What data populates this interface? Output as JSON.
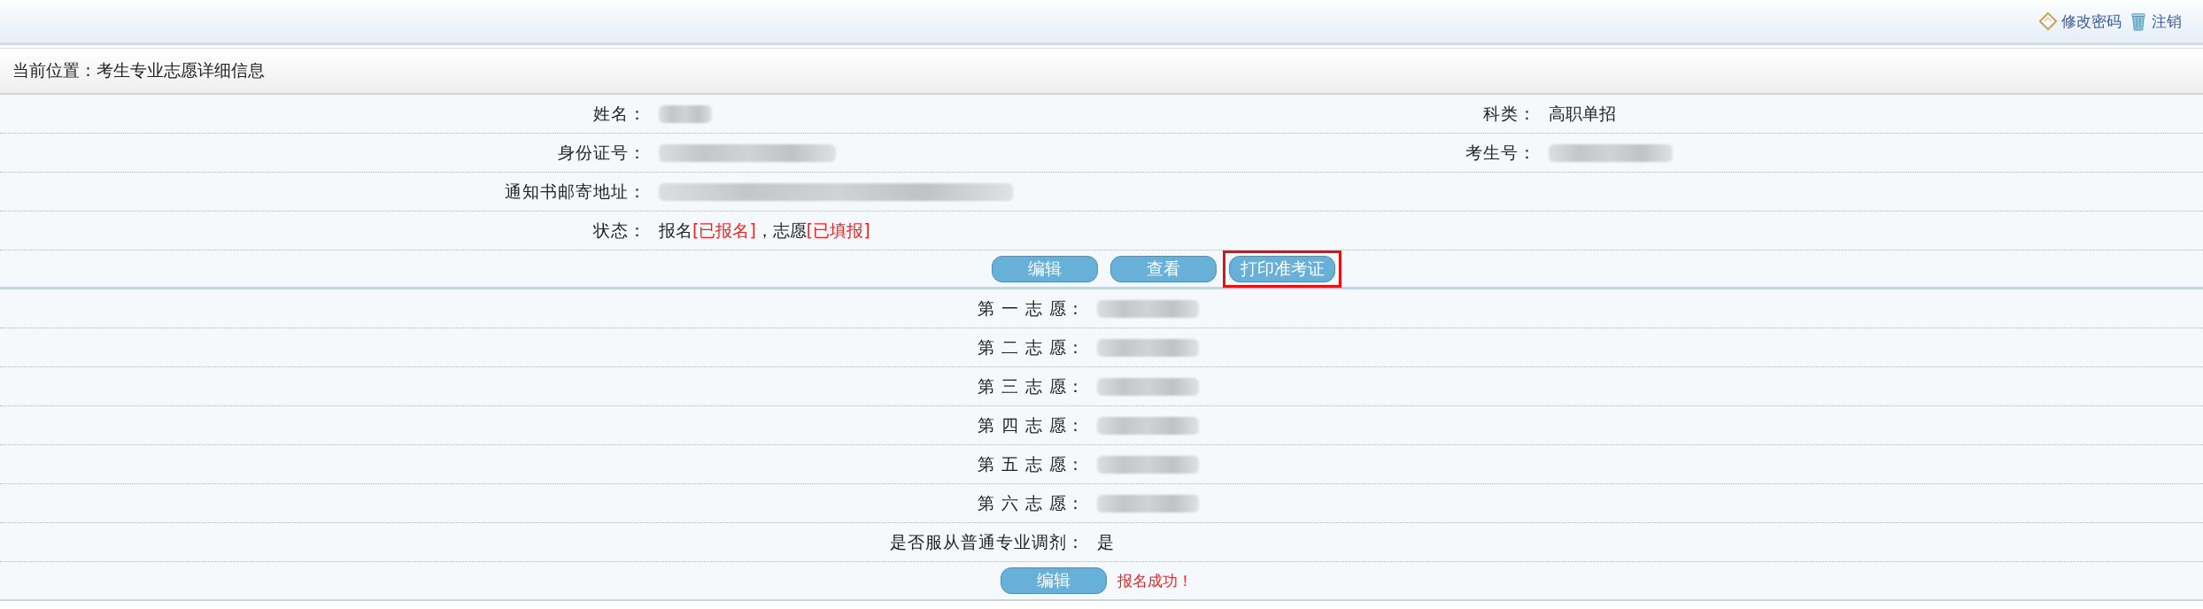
{
  "header": {
    "links": [
      {
        "kind": "password",
        "label": "修改密码"
      },
      {
        "kind": "logout",
        "label": "注销"
      }
    ]
  },
  "breadcrumb": "当前位置：考生专业志愿详细信息",
  "info": {
    "name_label": "姓名：",
    "category_label": "科类：",
    "category_value": "高职单招",
    "id_label": "身份证号：",
    "exam_no_label": "考生号：",
    "address_label": "通知书邮寄地址：",
    "status_label": "状态：",
    "status": [
      {
        "text": "报名",
        "highlight": false
      },
      {
        "text": "[已报名]",
        "highlight": true
      },
      {
        "text": "，志愿",
        "highlight": false
      },
      {
        "text": "[已填报]",
        "highlight": true
      }
    ]
  },
  "actions": [
    {
      "label": "编辑",
      "highlighted": false
    },
    {
      "label": "查看",
      "highlighted": false
    },
    {
      "label": "打印准考证",
      "highlighted": true
    }
  ],
  "choices": [
    {
      "label": "第 一 志 愿："
    },
    {
      "label": "第 二 志 愿："
    },
    {
      "label": "第 三 志 愿："
    },
    {
      "label": "第 四 志 愿："
    },
    {
      "label": "第 五 志 愿："
    },
    {
      "label": "第 六 志 愿："
    }
  ],
  "adjust": {
    "label": "是否服从普通专业调剂：",
    "value": "是"
  },
  "footer": {
    "button": "编辑",
    "message": "报名成功！"
  }
}
